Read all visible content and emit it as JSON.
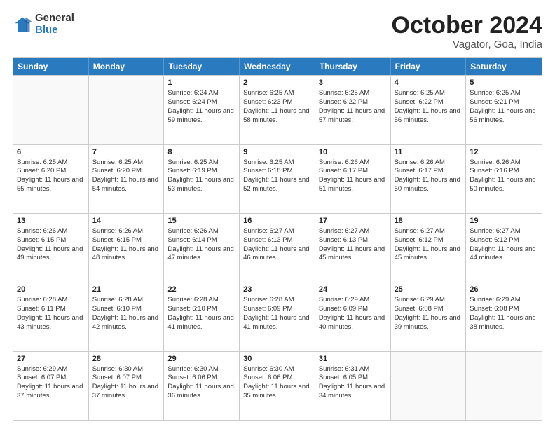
{
  "logo": {
    "general": "General",
    "blue": "Blue"
  },
  "header": {
    "month": "October 2024",
    "location": "Vagator, Goa, India"
  },
  "weekdays": [
    "Sunday",
    "Monday",
    "Tuesday",
    "Wednesday",
    "Thursday",
    "Friday",
    "Saturday"
  ],
  "rows": [
    [
      {
        "day": "",
        "sunrise": "",
        "sunset": "",
        "daylight": ""
      },
      {
        "day": "",
        "sunrise": "",
        "sunset": "",
        "daylight": ""
      },
      {
        "day": "1",
        "sunrise": "Sunrise: 6:24 AM",
        "sunset": "Sunset: 6:24 PM",
        "daylight": "Daylight: 11 hours and 59 minutes."
      },
      {
        "day": "2",
        "sunrise": "Sunrise: 6:25 AM",
        "sunset": "Sunset: 6:23 PM",
        "daylight": "Daylight: 11 hours and 58 minutes."
      },
      {
        "day": "3",
        "sunrise": "Sunrise: 6:25 AM",
        "sunset": "Sunset: 6:22 PM",
        "daylight": "Daylight: 11 hours and 57 minutes."
      },
      {
        "day": "4",
        "sunrise": "Sunrise: 6:25 AM",
        "sunset": "Sunset: 6:22 PM",
        "daylight": "Daylight: 11 hours and 56 minutes."
      },
      {
        "day": "5",
        "sunrise": "Sunrise: 6:25 AM",
        "sunset": "Sunset: 6:21 PM",
        "daylight": "Daylight: 11 hours and 56 minutes."
      }
    ],
    [
      {
        "day": "6",
        "sunrise": "Sunrise: 6:25 AM",
        "sunset": "Sunset: 6:20 PM",
        "daylight": "Daylight: 11 hours and 55 minutes."
      },
      {
        "day": "7",
        "sunrise": "Sunrise: 6:25 AM",
        "sunset": "Sunset: 6:20 PM",
        "daylight": "Daylight: 11 hours and 54 minutes."
      },
      {
        "day": "8",
        "sunrise": "Sunrise: 6:25 AM",
        "sunset": "Sunset: 6:19 PM",
        "daylight": "Daylight: 11 hours and 53 minutes."
      },
      {
        "day": "9",
        "sunrise": "Sunrise: 6:25 AM",
        "sunset": "Sunset: 6:18 PM",
        "daylight": "Daylight: 11 hours and 52 minutes."
      },
      {
        "day": "10",
        "sunrise": "Sunrise: 6:26 AM",
        "sunset": "Sunset: 6:17 PM",
        "daylight": "Daylight: 11 hours and 51 minutes."
      },
      {
        "day": "11",
        "sunrise": "Sunrise: 6:26 AM",
        "sunset": "Sunset: 6:17 PM",
        "daylight": "Daylight: 11 hours and 50 minutes."
      },
      {
        "day": "12",
        "sunrise": "Sunrise: 6:26 AM",
        "sunset": "Sunset: 6:16 PM",
        "daylight": "Daylight: 11 hours and 50 minutes."
      }
    ],
    [
      {
        "day": "13",
        "sunrise": "Sunrise: 6:26 AM",
        "sunset": "Sunset: 6:15 PM",
        "daylight": "Daylight: 11 hours and 49 minutes."
      },
      {
        "day": "14",
        "sunrise": "Sunrise: 6:26 AM",
        "sunset": "Sunset: 6:15 PM",
        "daylight": "Daylight: 11 hours and 48 minutes."
      },
      {
        "day": "15",
        "sunrise": "Sunrise: 6:26 AM",
        "sunset": "Sunset: 6:14 PM",
        "daylight": "Daylight: 11 hours and 47 minutes."
      },
      {
        "day": "16",
        "sunrise": "Sunrise: 6:27 AM",
        "sunset": "Sunset: 6:13 PM",
        "daylight": "Daylight: 11 hours and 46 minutes."
      },
      {
        "day": "17",
        "sunrise": "Sunrise: 6:27 AM",
        "sunset": "Sunset: 6:13 PM",
        "daylight": "Daylight: 11 hours and 45 minutes."
      },
      {
        "day": "18",
        "sunrise": "Sunrise: 6:27 AM",
        "sunset": "Sunset: 6:12 PM",
        "daylight": "Daylight: 11 hours and 45 minutes."
      },
      {
        "day": "19",
        "sunrise": "Sunrise: 6:27 AM",
        "sunset": "Sunset: 6:12 PM",
        "daylight": "Daylight: 11 hours and 44 minutes."
      }
    ],
    [
      {
        "day": "20",
        "sunrise": "Sunrise: 6:28 AM",
        "sunset": "Sunset: 6:11 PM",
        "daylight": "Daylight: 11 hours and 43 minutes."
      },
      {
        "day": "21",
        "sunrise": "Sunrise: 6:28 AM",
        "sunset": "Sunset: 6:10 PM",
        "daylight": "Daylight: 11 hours and 42 minutes."
      },
      {
        "day": "22",
        "sunrise": "Sunrise: 6:28 AM",
        "sunset": "Sunset: 6:10 PM",
        "daylight": "Daylight: 11 hours and 41 minutes."
      },
      {
        "day": "23",
        "sunrise": "Sunrise: 6:28 AM",
        "sunset": "Sunset: 6:09 PM",
        "daylight": "Daylight: 11 hours and 41 minutes."
      },
      {
        "day": "24",
        "sunrise": "Sunrise: 6:29 AM",
        "sunset": "Sunset: 6:09 PM",
        "daylight": "Daylight: 11 hours and 40 minutes."
      },
      {
        "day": "25",
        "sunrise": "Sunrise: 6:29 AM",
        "sunset": "Sunset: 6:08 PM",
        "daylight": "Daylight: 11 hours and 39 minutes."
      },
      {
        "day": "26",
        "sunrise": "Sunrise: 6:29 AM",
        "sunset": "Sunset: 6:08 PM",
        "daylight": "Daylight: 11 hours and 38 minutes."
      }
    ],
    [
      {
        "day": "27",
        "sunrise": "Sunrise: 6:29 AM",
        "sunset": "Sunset: 6:07 PM",
        "daylight": "Daylight: 11 hours and 37 minutes."
      },
      {
        "day": "28",
        "sunrise": "Sunrise: 6:30 AM",
        "sunset": "Sunset: 6:07 PM",
        "daylight": "Daylight: 11 hours and 37 minutes."
      },
      {
        "day": "29",
        "sunrise": "Sunrise: 6:30 AM",
        "sunset": "Sunset: 6:06 PM",
        "daylight": "Daylight: 11 hours and 36 minutes."
      },
      {
        "day": "30",
        "sunrise": "Sunrise: 6:30 AM",
        "sunset": "Sunset: 6:06 PM",
        "daylight": "Daylight: 11 hours and 35 minutes."
      },
      {
        "day": "31",
        "sunrise": "Sunrise: 6:31 AM",
        "sunset": "Sunset: 6:05 PM",
        "daylight": "Daylight: 11 hours and 34 minutes."
      },
      {
        "day": "",
        "sunrise": "",
        "sunset": "",
        "daylight": ""
      },
      {
        "day": "",
        "sunrise": "",
        "sunset": "",
        "daylight": ""
      }
    ]
  ]
}
